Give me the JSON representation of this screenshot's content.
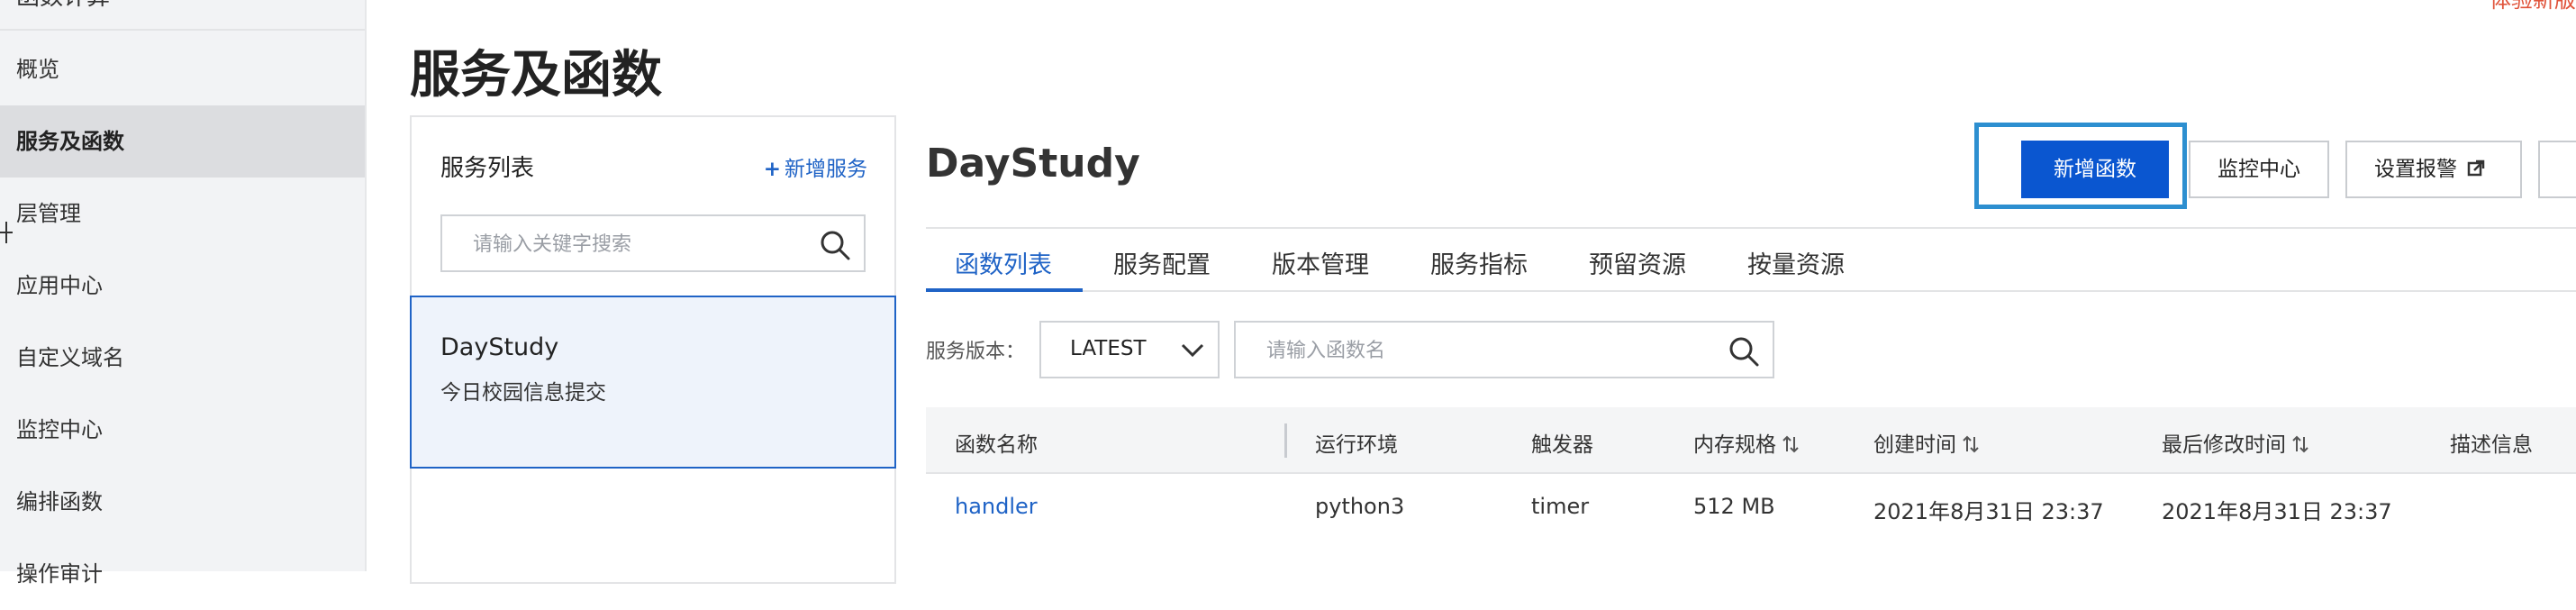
{
  "sidebar": {
    "top_partial": "函数计算",
    "items": [
      {
        "label": "概览"
      },
      {
        "label": "服务及函数",
        "active": true
      },
      {
        "label": "层管理"
      },
      {
        "label": "应用中心"
      },
      {
        "label": "自定义域名"
      },
      {
        "label": "监控中心"
      },
      {
        "label": "编排函数"
      },
      {
        "label": "操作审计"
      }
    ]
  },
  "corner_text": "体验新版",
  "page_title": "服务及函数",
  "service_panel": {
    "title": "服务列表",
    "add_service_label": "新增服务",
    "search_placeholder": "请输入关键字搜索",
    "services": [
      {
        "name": "DayStudy",
        "description": "今日校园信息提交"
      }
    ]
  },
  "main": {
    "service_title": "DayStudy",
    "buttons": {
      "new_function": "新增函数",
      "monitor_center": "监控中心",
      "set_alarm": "设置报警"
    },
    "tabs": [
      {
        "label": "函数列表",
        "active": true
      },
      {
        "label": "服务配置"
      },
      {
        "label": "版本管理"
      },
      {
        "label": "服务指标"
      },
      {
        "label": "预留资源"
      },
      {
        "label": "按量资源"
      }
    ],
    "version_label": "服务版本：",
    "version_value": "LATEST",
    "function_search_placeholder": "请输入函数名",
    "table": {
      "columns": [
        "函数名称",
        "运行环境",
        "触发器",
        "内存规格",
        "创建时间",
        "最后修改时间",
        "描述信息"
      ],
      "rows": [
        {
          "name": "handler",
          "runtime": "python3",
          "trigger": "timer",
          "memory": "512 MB",
          "created": "2021年8月31日 23:37",
          "modified": "2021年8月31日 23:37",
          "description": ""
        }
      ]
    }
  },
  "colors": {
    "accent": "#1f63c6",
    "primary_button": "#0a56d0",
    "highlight_border": "#2d8fd0",
    "corner_text": "#e0533a"
  }
}
